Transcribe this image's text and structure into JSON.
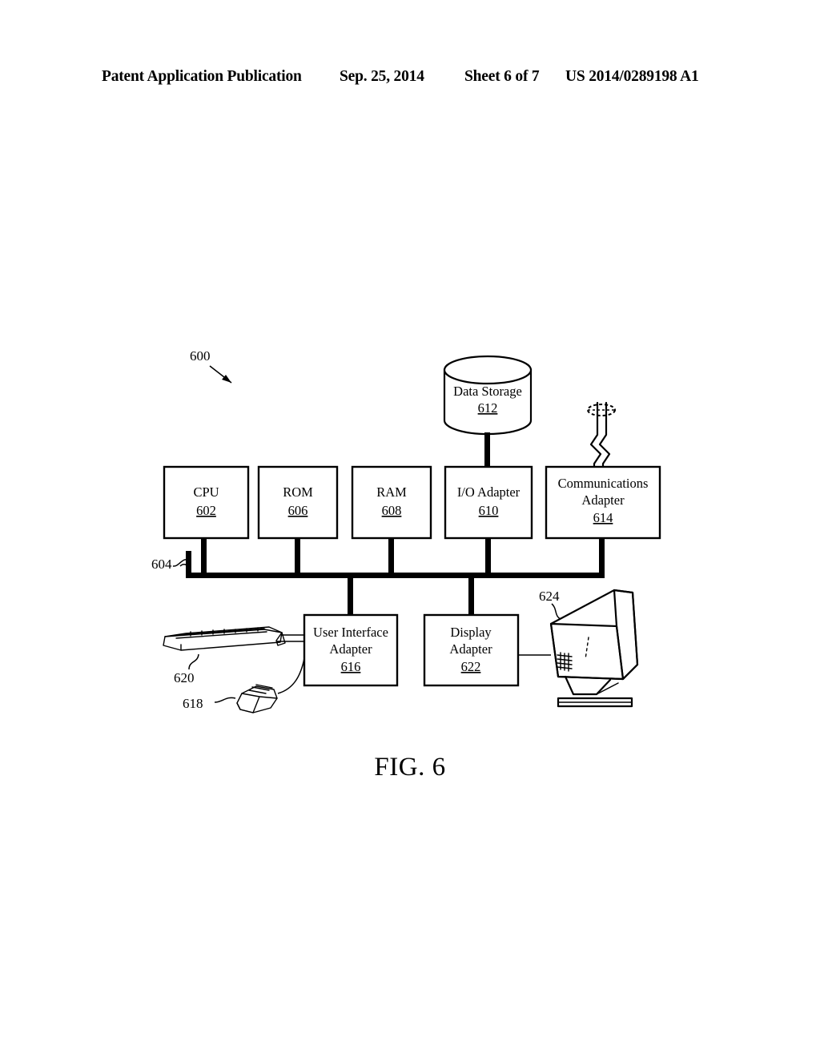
{
  "header": {
    "publication": "Patent Application Publication",
    "date": "Sep. 25, 2014",
    "sheet": "Sheet 6 of 7",
    "patent_number": "US 2014/0289198 A1"
  },
  "figure": {
    "caption": "FIG. 6",
    "system_ref": "600",
    "bus_ref": "604",
    "storage": {
      "label": "Data Storage",
      "ref": "612"
    },
    "blocks": [
      {
        "label": "CPU",
        "ref": "602"
      },
      {
        "label": "ROM",
        "ref": "606"
      },
      {
        "label": "RAM",
        "ref": "608"
      },
      {
        "label": "I/O Adapter",
        "ref": "610"
      },
      {
        "label_line1": "Communications",
        "label_line2": "Adapter",
        "ref": "614"
      }
    ],
    "lower_blocks": [
      {
        "label_line1": "User Interface",
        "label_line2": "Adapter",
        "ref": "616"
      },
      {
        "label_line1": "Display",
        "label_line2": "Adapter",
        "ref": "622"
      }
    ],
    "peripherals": [
      {
        "name": "keyboard",
        "ref": "620"
      },
      {
        "name": "mouse",
        "ref": "618"
      },
      {
        "name": "display-monitor",
        "ref": "624"
      }
    ]
  }
}
